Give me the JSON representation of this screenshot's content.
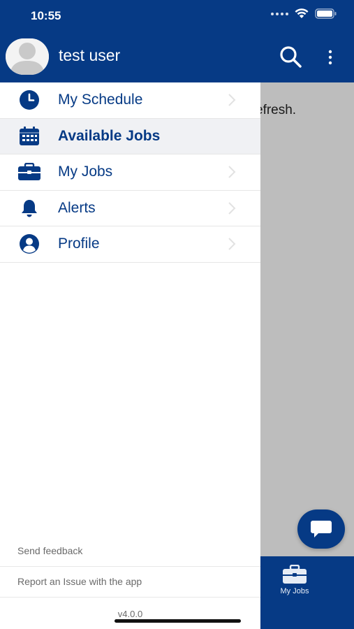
{
  "status_bar": {
    "time": "10:55"
  },
  "background": {
    "content_text": "efresh.",
    "bottom_tab_label": "My Jobs"
  },
  "drawer": {
    "user_name": "test user",
    "menu": [
      {
        "label": "My Schedule",
        "icon": "clock-icon",
        "active": false
      },
      {
        "label": "Available Jobs",
        "icon": "calendar-icon",
        "active": true
      },
      {
        "label": "My Jobs",
        "icon": "briefcase-icon",
        "active": false
      },
      {
        "label": "Alerts",
        "icon": "bell-icon",
        "active": false
      },
      {
        "label": "Profile",
        "icon": "user-circle-icon",
        "active": false
      }
    ],
    "footer": {
      "send_feedback": "Send feedback",
      "report_issue": "Report an Issue with the app",
      "version": "v4.0.0"
    }
  },
  "colors": {
    "brand": "#063a85",
    "active_row": "#f0f1f4",
    "overlay": "#bdbdbd"
  }
}
